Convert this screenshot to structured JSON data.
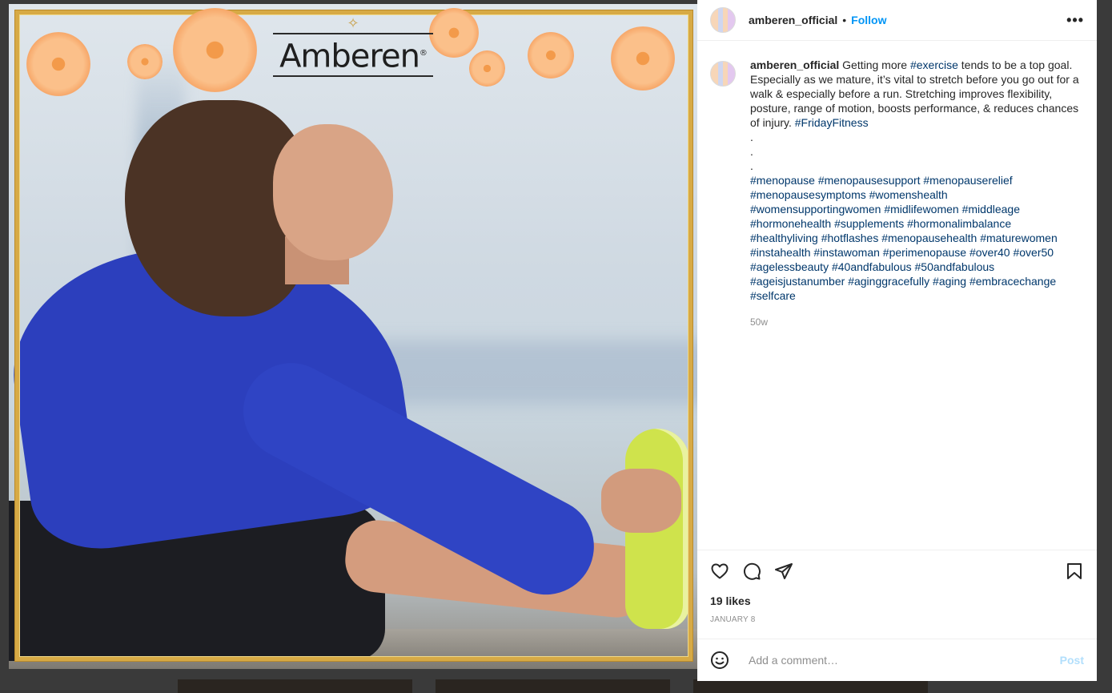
{
  "header": {
    "username": "amberen_official",
    "separator": "•",
    "follow_label": "Follow",
    "more_label": "•••"
  },
  "media": {
    "logo_text": "Amberen",
    "logo_mark": "®"
  },
  "caption": {
    "username": "amberen_official",
    "intro": " Getting more ",
    "tag_exercise": "#exercise",
    "body": " tends to be a top goal. Especially as we mature, it’s vital to stretch before you go out for a walk & especially before a run. Stretching improves flexibility, posture, range of motion, boosts performance, & reduces chances of injury. ",
    "tag_friday": "#FridayFitness",
    "dots": [
      ".",
      ".",
      "."
    ],
    "hashtags": [
      "#menopause",
      "#menopausesupport",
      "#menopauserelief",
      "#menopausesymptoms",
      "#womenshealth",
      "#womensupportingwomen",
      "#midlifewomen",
      "#middleage",
      "#hormonehealth",
      "#supplements",
      "#hormonalimbalance",
      "#healthyliving",
      "#hotflashes",
      "#menopausehealth",
      "#maturewomen",
      "#instahealth",
      "#instawoman",
      "#perimenopause",
      "#over40",
      "#over50",
      "#agelessbeauty",
      "#40andfabulous",
      "#50andfabulous",
      "#ageisjustanumber",
      "#aginggracefully",
      "#aging",
      "#embracechange",
      "#selfcare"
    ],
    "age": "50w"
  },
  "stats": {
    "likes": "19 likes",
    "date": "JANUARY 8"
  },
  "comment": {
    "placeholder": "Add a comment…",
    "post_label": "Post"
  },
  "colors": {
    "link_blue": "#0095f6",
    "hashtag": "#00376b",
    "post_disabled": "#b2dffc",
    "frame_gold": "#d7aa45"
  },
  "icons": [
    "heart-icon",
    "comment-icon",
    "share-icon",
    "bookmark-icon",
    "emoji-icon",
    "more-icon"
  ]
}
